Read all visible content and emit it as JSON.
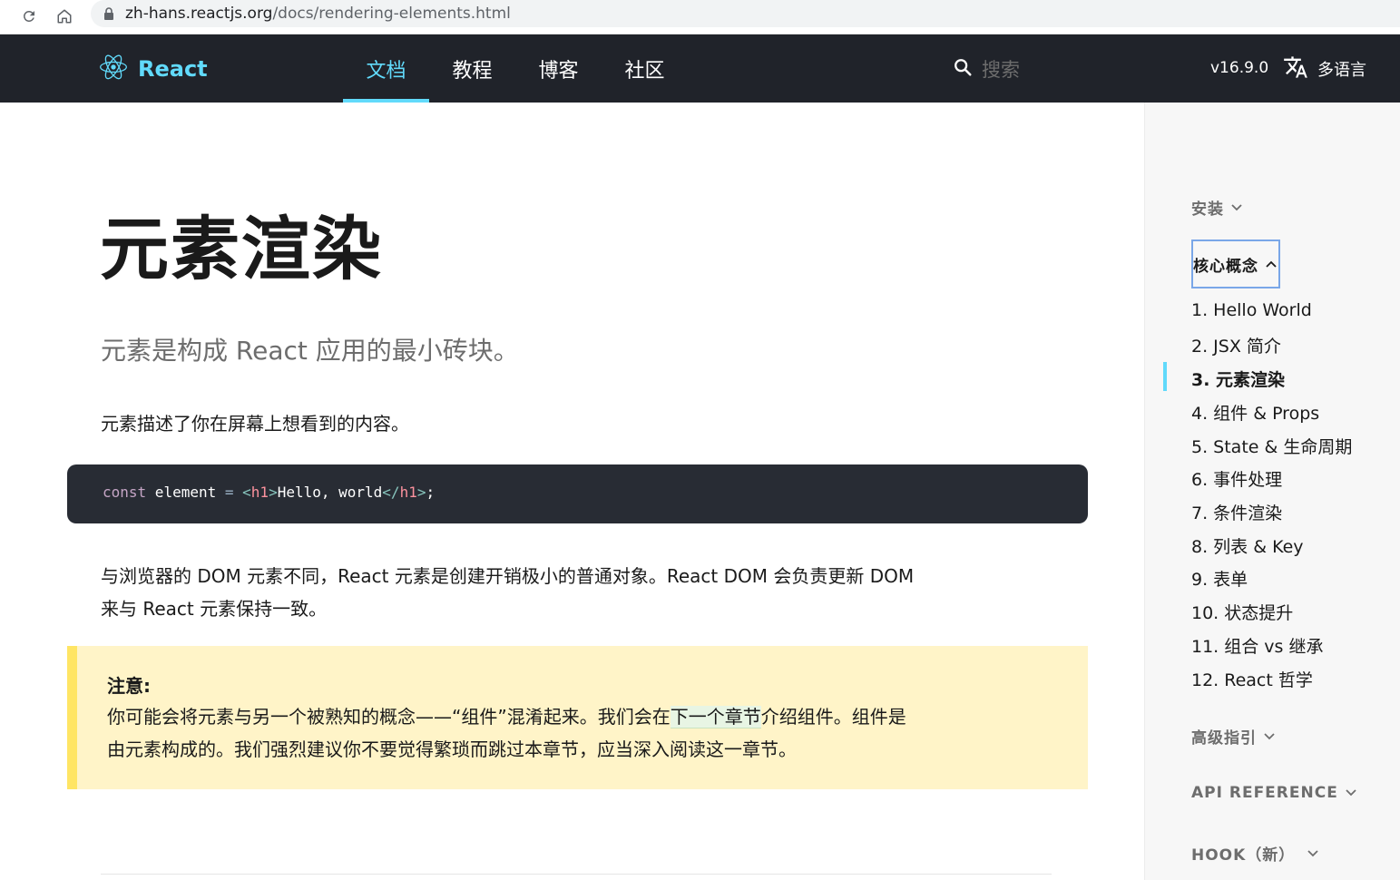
{
  "browser": {
    "url_host": "zh-hans.reactjs.org",
    "url_path": "/docs/rendering-elements.html"
  },
  "nav": {
    "logo_text": "React",
    "tabs": [
      {
        "label": "文档",
        "active": true
      },
      {
        "label": "教程",
        "active": false
      },
      {
        "label": "博客",
        "active": false
      },
      {
        "label": "社区",
        "active": false
      }
    ],
    "search_placeholder": "搜索",
    "version": "v16.9.0",
    "language_label": "多语言",
    "accent_color": "#61dafb",
    "bg_color": "#20232a"
  },
  "article": {
    "title": "元素渲染",
    "subtitle": "元素是构成 React 应用的最小砖块。",
    "para1": "元素描述了你在屏幕上想看到的内容。",
    "code": {
      "kw": "const",
      "var": " element ",
      "op": "=",
      "sp": " ",
      "open_lt": "<",
      "open_tag": "h1",
      "open_gt": ">",
      "text": "Hello, world",
      "close_lt": "</",
      "close_tag": "h1",
      "close_gt": ">",
      "semi": ";"
    },
    "para2": "与浏览器的 DOM 元素不同，React 元素是创建开销极小的普通对象。React DOM 会负责更新 DOM 来与 React 元素保持一致。",
    "note": {
      "title": "注意:",
      "body_before": "你可能会将元素与另一个被熟知的概念——“组件”混淆起来。我们会在",
      "link_text": "下一个章节",
      "body_after": "介绍组件。组件是由元素构成的。我们强烈建议你不要觉得繁琐而跳过本章节，应当深入阅读这一章节。"
    }
  },
  "sidebar": {
    "sections": [
      {
        "label": "安装",
        "expanded": false
      },
      {
        "label": "核心概念",
        "expanded": true
      },
      {
        "label": "高级指引",
        "expanded": false
      },
      {
        "label": "API REFERENCE",
        "expanded": false
      },
      {
        "label": "HOOK（新）",
        "expanded": false
      }
    ],
    "items": [
      {
        "label": "1. Hello World",
        "current": false
      },
      {
        "label": "2. JSX 简介",
        "current": false
      },
      {
        "label": "3. 元素渲染",
        "current": true
      },
      {
        "label": "4. 组件 & Props",
        "current": false
      },
      {
        "label": "5. State & 生命周期",
        "current": false
      },
      {
        "label": "6. 事件处理",
        "current": false
      },
      {
        "label": "7. 条件渲染",
        "current": false
      },
      {
        "label": "8. 列表 & Key",
        "current": false
      },
      {
        "label": "9. 表单",
        "current": false
      },
      {
        "label": "10. 状态提升",
        "current": false
      },
      {
        "label": "11. 组合 vs 继承",
        "current": false
      },
      {
        "label": "12. React 哲学",
        "current": false
      }
    ]
  }
}
